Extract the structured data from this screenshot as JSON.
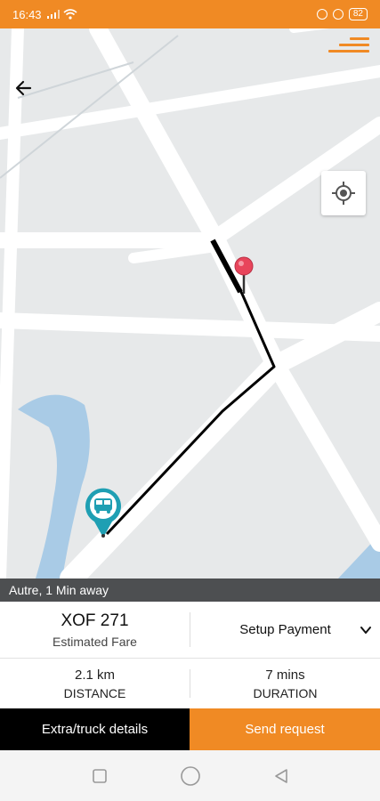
{
  "status_bar": {
    "time": "16:43",
    "battery": "82"
  },
  "map": {
    "icons": [
      "menu-icon",
      "back-arrow-icon",
      "my-location-icon",
      "destination-pin-icon",
      "vehicle-pin-icon"
    ]
  },
  "eta": {
    "text": "Autre, 1 Min away"
  },
  "fare": {
    "value": "XOF 271",
    "label": "Estimated Fare",
    "payment_label": "Setup Payment"
  },
  "stats": {
    "distance_value": "2.1 km",
    "distance_label": "DISTANCE",
    "duration_value": "7 mins",
    "duration_label": "DURATION"
  },
  "actions": {
    "extra_label": "Extra/truck details",
    "send_label": "Send request"
  },
  "colors": {
    "accent": "#f08a24",
    "eta_bar": "#4d4f51",
    "pin_destination": "#e8455b",
    "pin_vehicle": "#1f9fb3",
    "water": "#a9cbe6"
  }
}
